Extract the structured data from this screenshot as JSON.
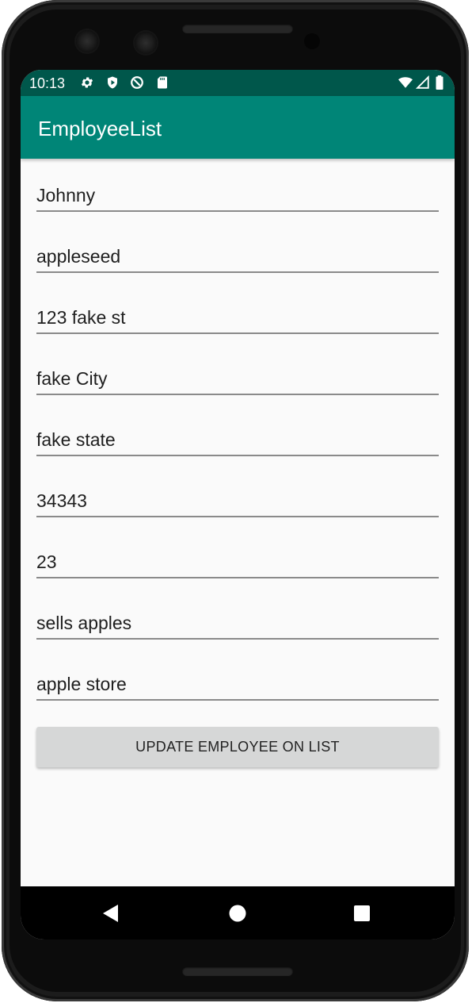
{
  "status_bar": {
    "time": "10:13",
    "left_icons": [
      "gear-icon",
      "shield-icon",
      "no-disturb-icon",
      "sd-card-icon"
    ],
    "right_icons": [
      "wifi-icon",
      "signal-icon",
      "battery-icon"
    ]
  },
  "app_bar": {
    "title": "EmployeeList"
  },
  "form": {
    "fields": [
      {
        "value": "Johnny"
      },
      {
        "value": "appleseed"
      },
      {
        "value": "123 fake st"
      },
      {
        "value": "fake City"
      },
      {
        "value": "fake state"
      },
      {
        "value": "34343"
      },
      {
        "value": "23"
      },
      {
        "value": "sells apples"
      },
      {
        "value": "apple store"
      }
    ],
    "update_button_label": "UPDATE EMPLOYEE ON LIST"
  },
  "nav_bar": {
    "icons": [
      "back-icon",
      "home-icon",
      "recents-icon"
    ]
  },
  "colors": {
    "status_bar": "#00574b",
    "app_bar": "#008577",
    "background": "#fafafa",
    "button": "#d6d7d7"
  }
}
